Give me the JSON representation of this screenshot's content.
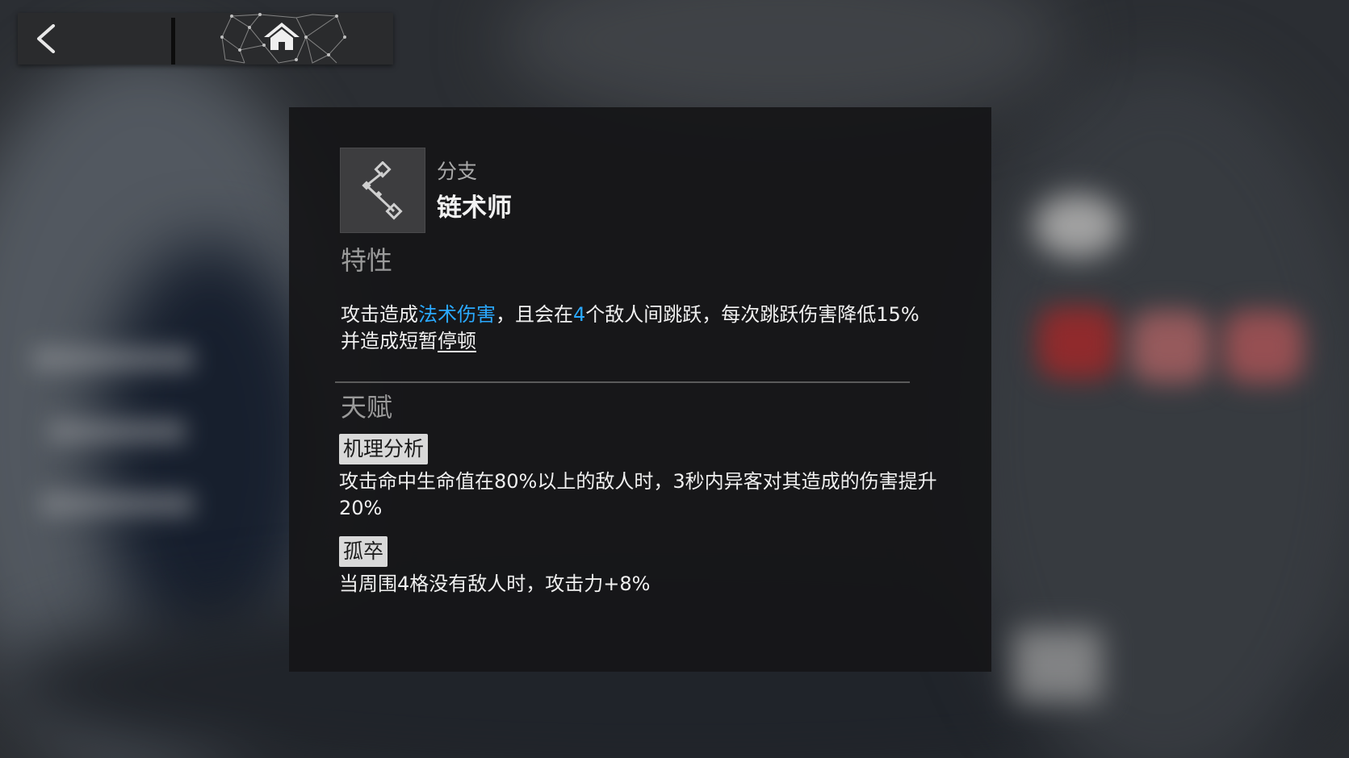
{
  "nav": {
    "back_icon": "chevron-left-icon",
    "home_icon": "home-icon"
  },
  "branch": {
    "label": "分支",
    "name": "链术师",
    "icon": "chain-branch-icon"
  },
  "trait": {
    "title": "特性",
    "parts": {
      "p1": "攻击造成",
      "h1": "法术伤害",
      "p2": "，且会在",
      "h2": "4",
      "p3": "个敌人间跳跃，每次跳跃伤害降低15%并造成短暂",
      "term": "停顿"
    }
  },
  "talents": {
    "title": "天赋",
    "items": [
      {
        "name": "机理分析",
        "desc": "攻击命中生命值在80%以上的敌人时，3秒内异客对其造成的伤害提升20%"
      },
      {
        "name": "孤卒",
        "desc": "当周围4格没有敌人时，攻击力+8%"
      }
    ]
  },
  "colors": {
    "highlight": "#2aa9ff",
    "panel": "#161618",
    "tag_bg": "#d9d9d9"
  }
}
